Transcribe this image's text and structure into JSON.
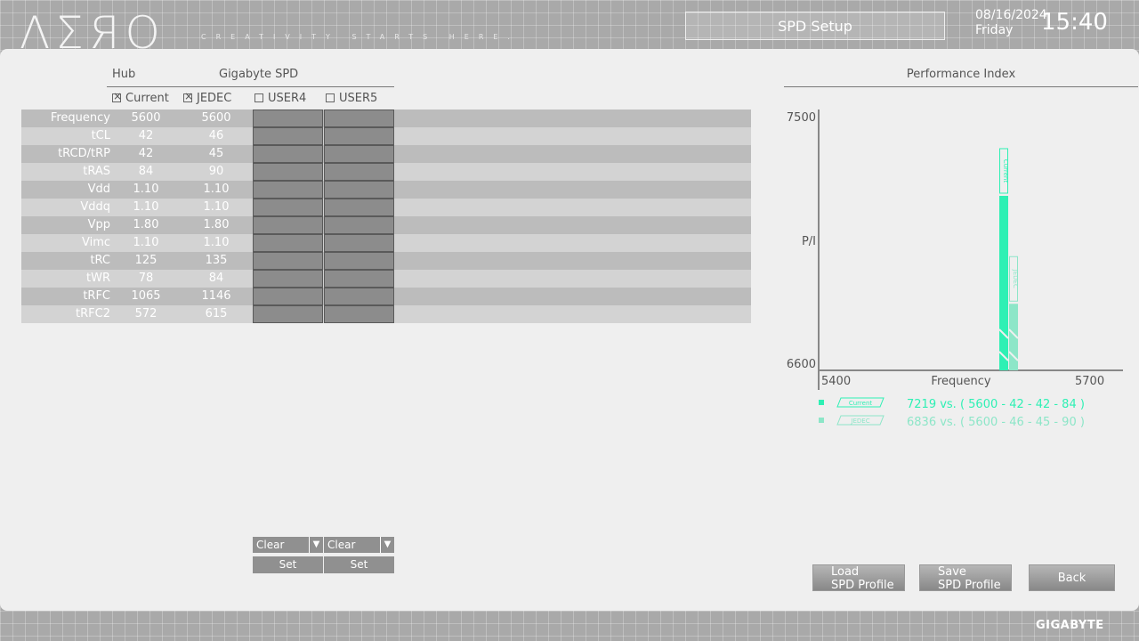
{
  "header": {
    "logo": "AERO",
    "slogan": "CREATIVITY STARTS HERE.",
    "title": "SPD Setup",
    "date": "08/16/2024",
    "day": "Friday",
    "time": "15:40"
  },
  "table": {
    "hub_label": "Hub",
    "spd_label": "Gigabyte SPD",
    "profiles": [
      {
        "label": "Current",
        "checked": true
      },
      {
        "label": "JEDEC",
        "checked": true
      },
      {
        "label": "USER4",
        "checked": false
      },
      {
        "label": "USER5",
        "checked": false
      }
    ],
    "rows": [
      {
        "name": "Frequency",
        "current": "5600",
        "jedec": "5600"
      },
      {
        "name": "tCL",
        "current": "42",
        "jedec": "46"
      },
      {
        "name": "tRCD/tRP",
        "current": "42",
        "jedec": "45"
      },
      {
        "name": "tRAS",
        "current": "84",
        "jedec": "90"
      },
      {
        "name": "Vdd",
        "current": "1.10",
        "jedec": "1.10"
      },
      {
        "name": "Vddq",
        "current": "1.10",
        "jedec": "1.10"
      },
      {
        "name": "Vpp",
        "current": "1.80",
        "jedec": "1.80"
      },
      {
        "name": "Vimc",
        "current": "1.10",
        "jedec": "1.10"
      },
      {
        "name": "tRC",
        "current": "125",
        "jedec": "135"
      },
      {
        "name": "tWR",
        "current": "78",
        "jedec": "84"
      },
      {
        "name": "tRFC",
        "current": "1065",
        "jedec": "1146"
      },
      {
        "name": "tRFC2",
        "current": "572",
        "jedec": "615"
      }
    ],
    "user4": {
      "dropdown": "Clear",
      "set": "Set"
    },
    "user5": {
      "dropdown": "Clear",
      "set": "Set"
    }
  },
  "performance": {
    "title": "Performance Index"
  },
  "chart_data": {
    "type": "bar",
    "xlabel": "Frequency",
    "ylabel": "P/I",
    "xlim": [
      5400,
      5700
    ],
    "ylim": [
      6600,
      7500
    ],
    "x_ticks": [
      "5400",
      "5700"
    ],
    "y_ticks": [
      "7500",
      "6600"
    ],
    "series": [
      {
        "name": "Current",
        "x": 5600,
        "value": 7219,
        "color": "#2ef0b4",
        "legend_text": "7219  vs. ( 5600  -  42  -  42  -  84 )"
      },
      {
        "name": "JEDEC",
        "x": 5600,
        "value": 6836,
        "color": "#8de6c8",
        "legend_text": "6836  vs. ( 5600  -  46  -  45  -  90 )"
      }
    ]
  },
  "buttons": {
    "load": [
      "Load",
      "SPD Profile"
    ],
    "save": [
      "Save",
      "SPD Profile"
    ],
    "back": "Back"
  },
  "footer": {
    "brand": "GIGABYTE"
  }
}
